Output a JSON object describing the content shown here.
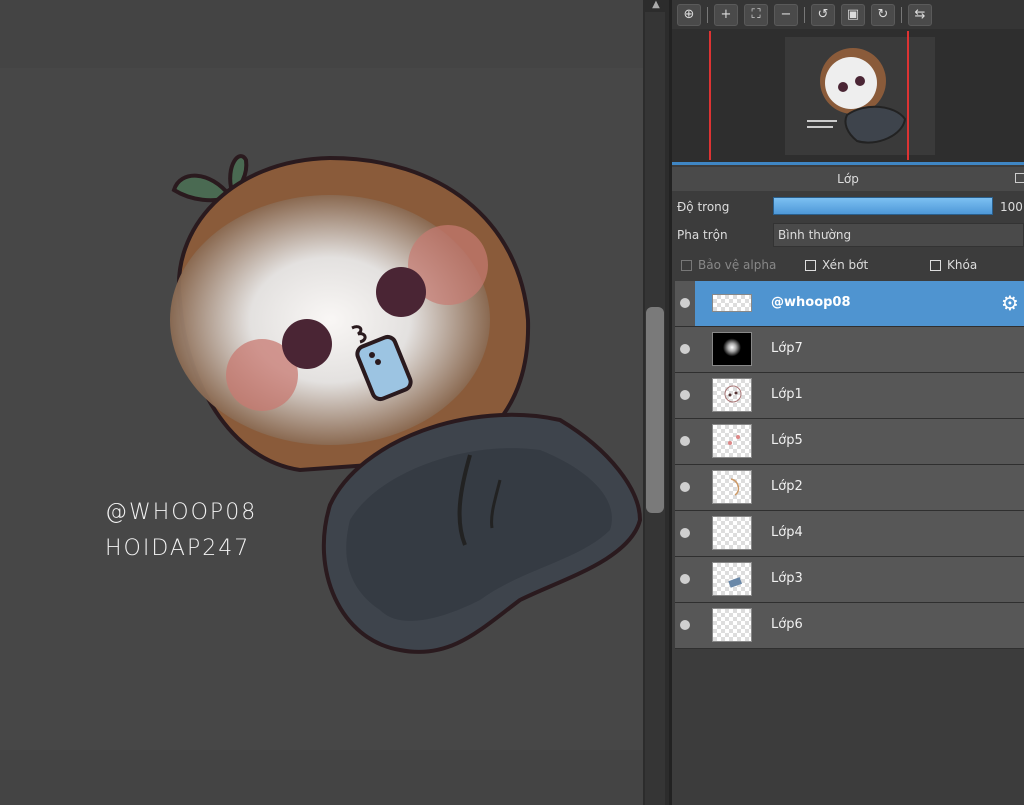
{
  "watermark": {
    "line1": "@WHOOP08",
    "line2": "HOIDAP247"
  },
  "panel": {
    "layers_title": "Lớp",
    "opacity_label": "Độ trong",
    "opacity_value": "100",
    "opacity_fraction": 1.0,
    "blend_label": "Pha trộn",
    "blend_value": "Bình thường",
    "protect_alpha": "Bảo vệ alpha",
    "clip": "Xén bớt",
    "lock": "Khóa",
    "layers": [
      {
        "name": "@whoop08",
        "selected": true,
        "thumb": "watermark-text"
      },
      {
        "name": "Lớp7",
        "selected": false,
        "thumb": "glow"
      },
      {
        "name": "Lớp1",
        "selected": false,
        "thumb": "face"
      },
      {
        "name": "Lớp5",
        "selected": false,
        "thumb": "blush"
      },
      {
        "name": "Lớp2",
        "selected": false,
        "thumb": "sketch"
      },
      {
        "name": "Lớp4",
        "selected": false,
        "thumb": "empty"
      },
      {
        "name": "Lớp3",
        "selected": false,
        "thumb": "phone"
      },
      {
        "name": "Lớp6",
        "selected": false,
        "thumb": "empty"
      }
    ]
  },
  "toolbar_icons": [
    "zoom-100-icon",
    "zoom-in-icon",
    "fit-screen-icon",
    "zoom-out-icon",
    "rotate-left-icon",
    "fullscreen-icon",
    "rotate-right-icon",
    "flip-horizontal-icon"
  ],
  "colors": {
    "accent": "#4f94d0",
    "view_frame": "#dd3333",
    "opacity_fill": "#5fa8e6"
  }
}
